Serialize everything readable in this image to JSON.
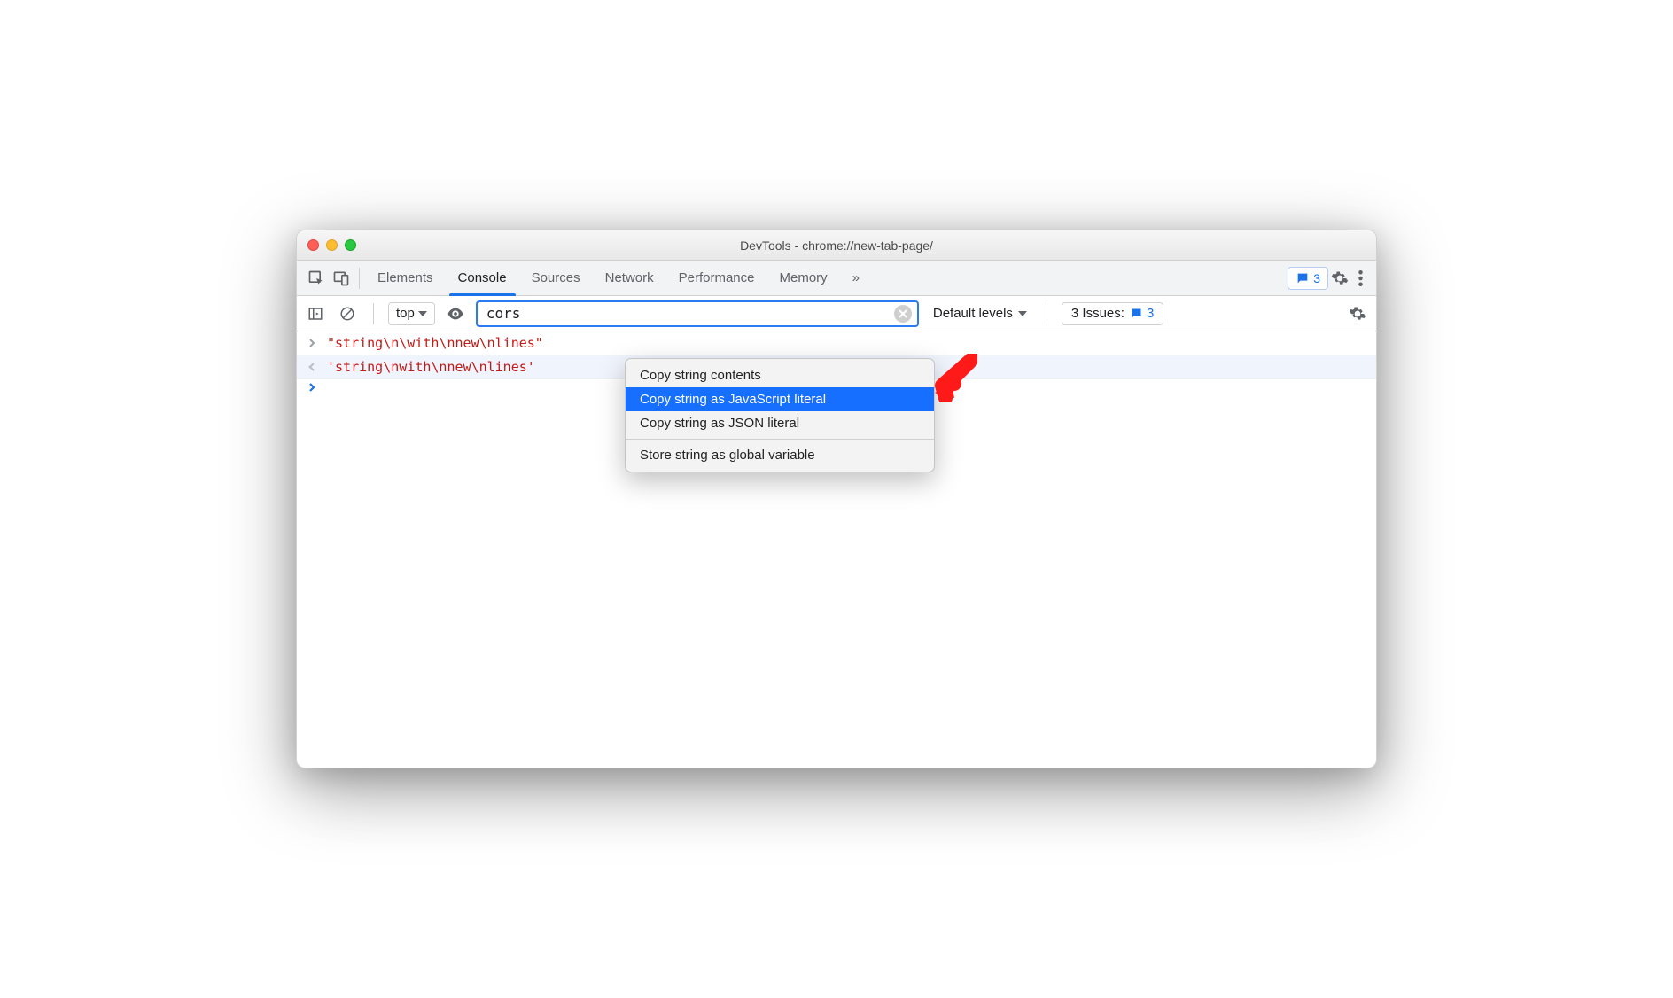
{
  "window": {
    "title": "DevTools - chrome://new-tab-page/"
  },
  "tabs": {
    "items": [
      "Elements",
      "Console",
      "Sources",
      "Network",
      "Performance",
      "Memory"
    ],
    "active": "Console",
    "overflow": "»",
    "messages_count": "3"
  },
  "filter": {
    "context": "top",
    "value": "cors",
    "levels_label": "Default levels",
    "issues_label": "3 Issues:",
    "issues_count": "3"
  },
  "console": {
    "line1": "\"string\\n\\with\\nnew\\nlines\"",
    "line2": "'string\\nwith\\nnew\\nlines'"
  },
  "contextmenu": {
    "items": [
      "Copy string contents",
      "Copy string as JavaScript literal",
      "Copy string as JSON literal",
      "Store string as global variable"
    ],
    "selected": 1
  }
}
